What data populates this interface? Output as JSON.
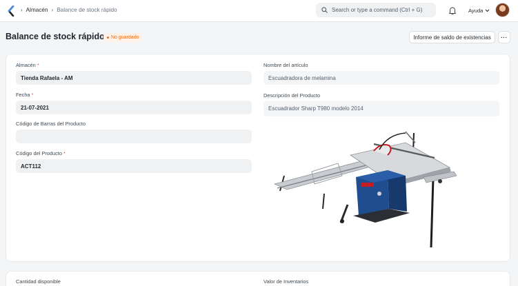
{
  "navbar": {
    "breadcrumb_1": "Almacén",
    "breadcrumb_2": "Balance de stock rápido",
    "search_placeholder": "Search or type a command (Ctrl + G)",
    "help_label": "Ayuda"
  },
  "page": {
    "title": "Balance de stock rápido",
    "status": "No guardado",
    "report_button": "Informe de saldo de existencias",
    "more_button": "···"
  },
  "form": {
    "warehouse": {
      "label": "Almacén",
      "value": "Tienda Rafaela - AM",
      "required": "*"
    },
    "date": {
      "label": "Fecha",
      "value": "21-07-2021",
      "required": "*"
    },
    "barcode": {
      "label": "Código de Barras del Producto",
      "value": ""
    },
    "item_code": {
      "label": "Código del Producto",
      "value": "ACT112",
      "required": "*"
    },
    "item_name": {
      "label": "Nombre del artículo",
      "value": "Escuadradora de melamina"
    },
    "description": {
      "label": "Descripción del Producto",
      "value": "Escuadrador Sharp T980 modelo 2014"
    },
    "qty": {
      "label": "Cantidad disponible"
    },
    "value": {
      "label": "Valor de Inventarios"
    }
  },
  "colors": {
    "status": "#e86c13",
    "required": "#e24c4c"
  },
  "icons": [
    "app-logo-icon",
    "chevron-right-icon",
    "search-icon",
    "bell-icon",
    "chevron-down-icon"
  ]
}
